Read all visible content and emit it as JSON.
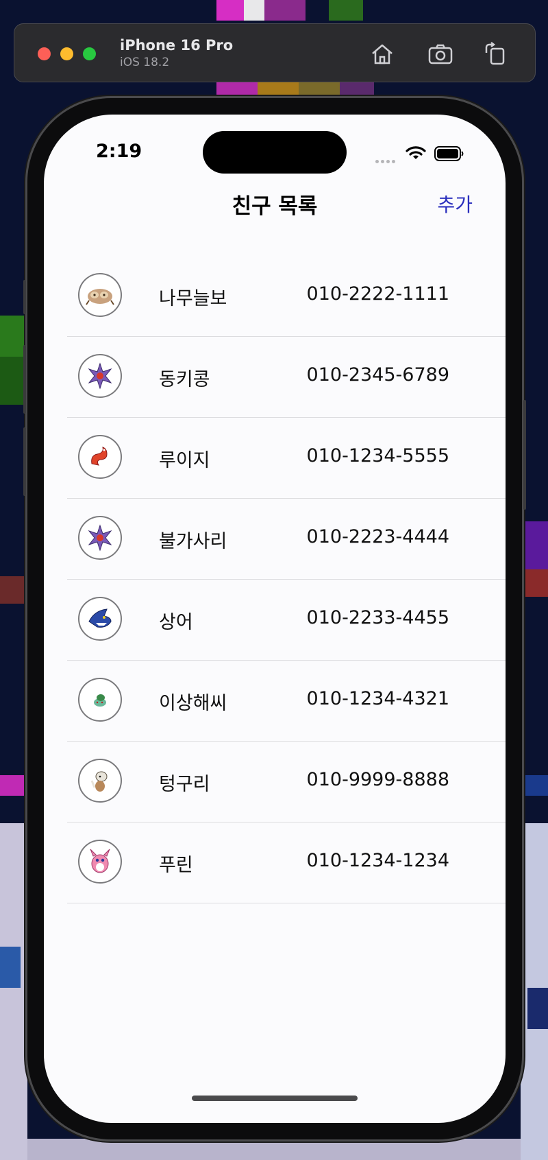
{
  "simulator": {
    "device_name": "iPhone 16 Pro",
    "os_version": "iOS 18.2",
    "icons": [
      "home-icon",
      "screenshot-icon",
      "rotate-icon"
    ]
  },
  "status_bar": {
    "time": "2:19",
    "icons": [
      "wifi-icon",
      "battery-icon"
    ]
  },
  "nav": {
    "title": "친구 목록",
    "add_label": "추가",
    "accent_color": "#2a2ebd"
  },
  "friends": [
    {
      "name": "나무늘보",
      "phone": "010-2222-1111",
      "avatar_icon": "sloth-pokemon-icon"
    },
    {
      "name": "동키콩",
      "phone": "010-2345-6789",
      "avatar_icon": "starmie-pokemon-icon"
    },
    {
      "name": "루이지",
      "phone": "010-1234-5555",
      "avatar_icon": "red-worm-pokemon-icon"
    },
    {
      "name": "불가사리",
      "phone": "010-2223-4444",
      "avatar_icon": "starmie-pokemon-icon"
    },
    {
      "name": "상어",
      "phone": "010-2233-4455",
      "avatar_icon": "shark-pokemon-icon"
    },
    {
      "name": "이상해씨",
      "phone": "010-1234-4321",
      "avatar_icon": "bulbasaur-pokemon-icon"
    },
    {
      "name": "텅구리",
      "phone": "010-9999-8888",
      "avatar_icon": "cubone-pokemon-icon"
    },
    {
      "name": "푸린",
      "phone": "010-1234-1234",
      "avatar_icon": "wigglytuff-pokemon-icon"
    }
  ]
}
